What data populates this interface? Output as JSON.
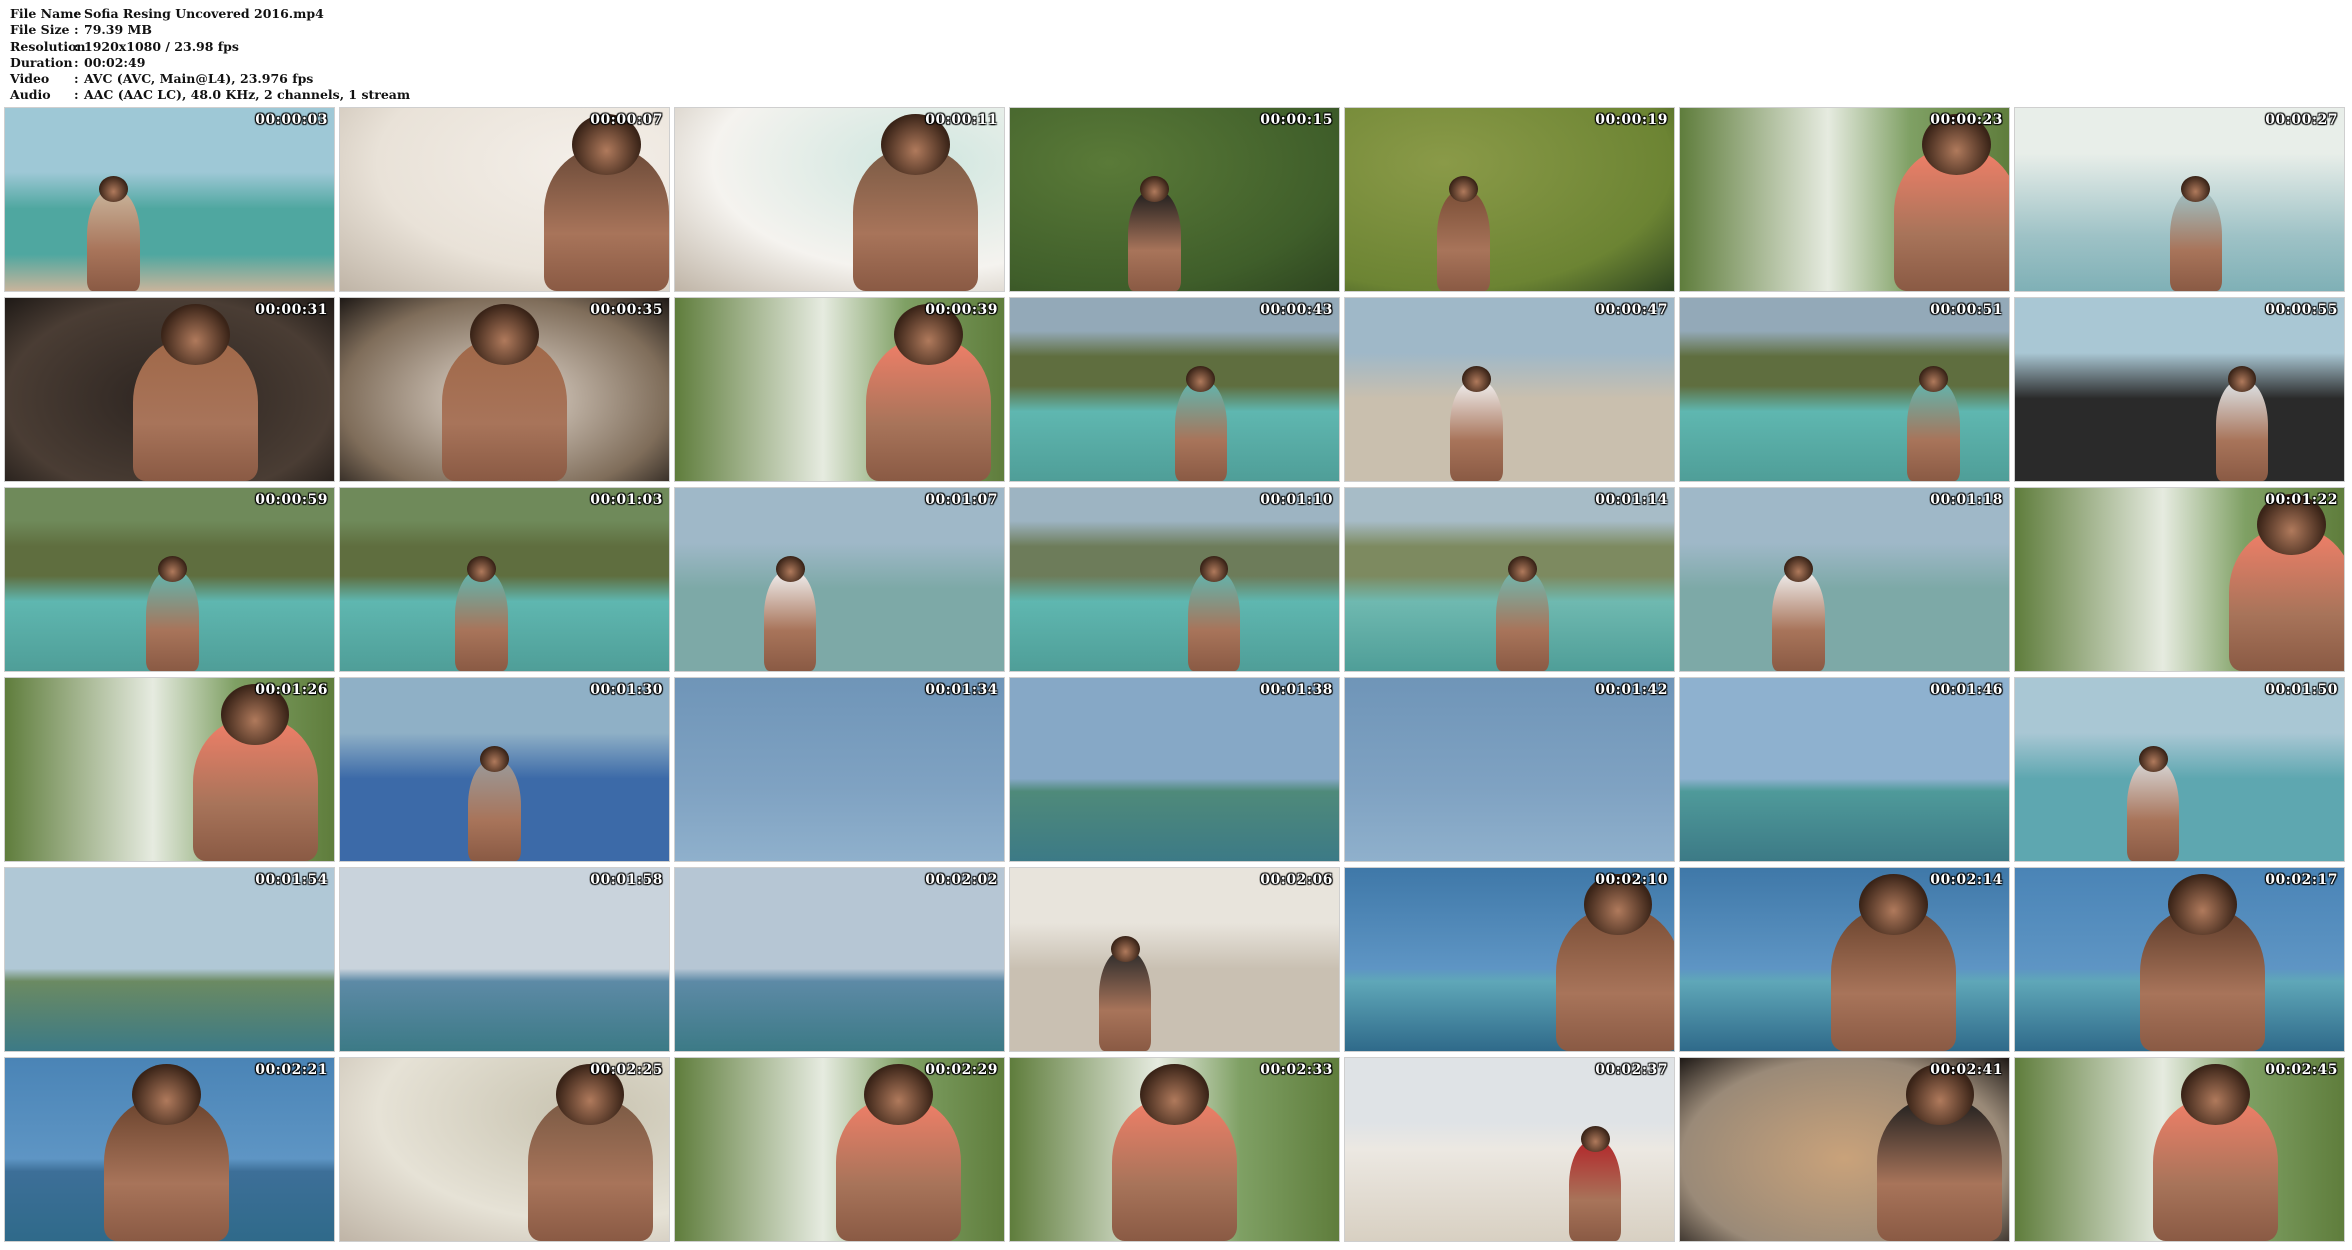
{
  "info": {
    "rows": [
      {
        "key": "File Name",
        "sep": ":",
        "value": "Sofia Resing Uncovered 2016.mp4"
      },
      {
        "key": "File Size",
        "sep": ":",
        "value": "79.39 MB"
      },
      {
        "key": "Resolution",
        "sep": ":",
        "value": "1920x1080 / 23.98 fps"
      },
      {
        "key": "Duration",
        "sep": ":",
        "value": "00:02:49"
      },
      {
        "key": "Video",
        "sep": ":",
        "value": "AVC (AVC, Main@L4), 23.976 fps"
      },
      {
        "key": "Audio",
        "sep": ":",
        "value": "AAC (AAC LC), 48.0 KHz, 2 channels, 1 stream"
      }
    ]
  },
  "thumbnails": [
    {
      "timestamp": "00:00:03",
      "scene": "beach-pier",
      "colors": [
        "#9ec8d6",
        "#4fa7a0",
        "#c9b49b"
      ]
    },
    {
      "timestamp": "00:00:07",
      "scene": "portrait-light",
      "colors": [
        "#e9e2d8",
        "#f4efe9",
        "#6b4a38"
      ]
    },
    {
      "timestamp": "00:00:11",
      "scene": "portrait-light",
      "colors": [
        "#f5f3ef",
        "#cfe6df",
        "#7a5a44"
      ]
    },
    {
      "timestamp": "00:00:15",
      "scene": "foliage",
      "colors": [
        "#5a7a38",
        "#3f5e2a",
        "#1c1c1c"
      ]
    },
    {
      "timestamp": "00:00:19",
      "scene": "foliage",
      "colors": [
        "#8a9a48",
        "#6c8433",
        "#7a4e36"
      ]
    },
    {
      "timestamp": "00:00:23",
      "scene": "hut",
      "colors": [
        "#8c6a42",
        "#5f7d3c",
        "#f27f68"
      ]
    },
    {
      "timestamp": "00:00:27",
      "scene": "cliff-sea",
      "colors": [
        "#e8eee9",
        "#3e6b3a",
        "#9ec2c6"
      ]
    },
    {
      "timestamp": "00:00:31",
      "scene": "rock",
      "colors": [
        "#4a3d34",
        "#2c2420",
        "#a06848"
      ]
    },
    {
      "timestamp": "00:00:35",
      "scene": "rock",
      "colors": [
        "#7f6d5a",
        "#e6dcd2",
        "#a06848"
      ]
    },
    {
      "timestamp": "00:00:39",
      "scene": "hut",
      "colors": [
        "#8c6a42",
        "#5f7d3c",
        "#f27f68"
      ]
    },
    {
      "timestamp": "00:00:43",
      "scene": "shore",
      "colors": [
        "#93a9b8",
        "#5f6e3f",
        "#5fb7b0"
      ]
    },
    {
      "timestamp": "00:00:47",
      "scene": "crew-beach",
      "colors": [
        "#9fb8c8",
        "#c9bfae",
        "#f2f2f2"
      ]
    },
    {
      "timestamp": "00:00:51",
      "scene": "shore",
      "colors": [
        "#93a9b8",
        "#5f6e3f",
        "#5fb7b0"
      ]
    },
    {
      "timestamp": "00:00:55",
      "scene": "crew-beach",
      "colors": [
        "#a9c7d4",
        "#2a2a2a",
        "#dfe6ea"
      ]
    },
    {
      "timestamp": "00:00:59",
      "scene": "shore",
      "colors": [
        "#6f8a5a",
        "#5f6e3f",
        "#5fb7b0"
      ]
    },
    {
      "timestamp": "00:01:03",
      "scene": "shore",
      "colors": [
        "#6f8a5a",
        "#5f6e3f",
        "#5fb7b0"
      ]
    },
    {
      "timestamp": "00:01:07",
      "scene": "crew-beach",
      "colors": [
        "#9fb8c8",
        "#7da9a7",
        "#f2f2f2"
      ]
    },
    {
      "timestamp": "00:01:10",
      "scene": "shore",
      "colors": [
        "#9db4c2",
        "#6d7c5a",
        "#5fb7b0"
      ]
    },
    {
      "timestamp": "00:01:14",
      "scene": "shore",
      "colors": [
        "#a7bcc7",
        "#7d8a60",
        "#6fb9b0"
      ]
    },
    {
      "timestamp": "00:01:18",
      "scene": "crew-beach",
      "colors": [
        "#9fb8c8",
        "#7da9a7",
        "#f2f2f2"
      ]
    },
    {
      "timestamp": "00:01:22",
      "scene": "hut",
      "colors": [
        "#8c6a42",
        "#5f7d3c",
        "#f27f68"
      ]
    },
    {
      "timestamp": "00:01:26",
      "scene": "hut",
      "colors": [
        "#8c6a42",
        "#5f7d3c",
        "#f27f68"
      ]
    },
    {
      "timestamp": "00:01:30",
      "scene": "crew-beach",
      "colors": [
        "#8fb0c6",
        "#3c6aa8",
        "#9a9a9a"
      ]
    },
    {
      "timestamp": "00:01:34",
      "scene": "sky",
      "colors": [
        "#7fa2c2",
        "#7fa2c2",
        "#e8e8e8"
      ]
    },
    {
      "timestamp": "00:01:38",
      "scene": "sky-sea",
      "colors": [
        "#86a8c6",
        "#4f8a7a",
        "#e8e8e8"
      ]
    },
    {
      "timestamp": "00:01:42",
      "scene": "sky",
      "colors": [
        "#7fa2c2",
        "#7fa2c2",
        "#e8e8e8"
      ]
    },
    {
      "timestamp": "00:01:46",
      "scene": "sky-sea",
      "colors": [
        "#8eb1cf",
        "#4f9a9a",
        "#e0a33a"
      ]
    },
    {
      "timestamp": "00:01:50",
      "scene": "crew-beach",
      "colors": [
        "#a9c7d4",
        "#5ea7b0",
        "#d8d8d8"
      ]
    },
    {
      "timestamp": "00:01:54",
      "scene": "sky-sea",
      "colors": [
        "#b0c8d6",
        "#6b8a62",
        "#e8e8e8"
      ]
    },
    {
      "timestamp": "00:01:58",
      "scene": "sky-sea",
      "colors": [
        "#c9d3dc",
        "#5d8aa6",
        "#2a2a2a"
      ]
    },
    {
      "timestamp": "00:02:02",
      "scene": "sky-sea",
      "colors": [
        "#b6c6d4",
        "#5d8aa6",
        "#2a2a2a"
      ]
    },
    {
      "timestamp": "00:02:06",
      "scene": "crew-beach",
      "colors": [
        "#e8e4dc",
        "#c9c0b2",
        "#2a2a2a"
      ]
    },
    {
      "timestamp": "00:02:10",
      "scene": "portrait-sea",
      "colors": [
        "#3f78a8",
        "#5fa7b8",
        "#7a4e36"
      ]
    },
    {
      "timestamp": "00:02:14",
      "scene": "portrait-sea",
      "colors": [
        "#3f78a8",
        "#5fa7b8",
        "#6a432d"
      ]
    },
    {
      "timestamp": "00:02:17",
      "scene": "portrait-sea",
      "colors": [
        "#4a84b6",
        "#5fa7b8",
        "#5c3a28"
      ]
    },
    {
      "timestamp": "00:02:21",
      "scene": "portrait-sea",
      "colors": [
        "#4a84b6",
        "#3d6f98",
        "#6a432d"
      ]
    },
    {
      "timestamp": "00:02:25",
      "scene": "portrait-light",
      "colors": [
        "#e6e2d6",
        "#c8c3b0",
        "#7a5a44"
      ]
    },
    {
      "timestamp": "00:02:29",
      "scene": "hut",
      "colors": [
        "#8c6a42",
        "#5f7d3c",
        "#f27f68"
      ]
    },
    {
      "timestamp": "00:02:33",
      "scene": "hut",
      "colors": [
        "#8c6a42",
        "#5f7d3c",
        "#f27f68"
      ]
    },
    {
      "timestamp": "00:02:37",
      "scene": "white-beach",
      "colors": [
        "#dfe3e6",
        "#ece8e2",
        "#b3262a"
      ]
    },
    {
      "timestamp": "00:02:41",
      "scene": "rock",
      "colors": [
        "#9a8a78",
        "#c9a27a",
        "#1e1e1e"
      ]
    },
    {
      "timestamp": "00:02:45",
      "scene": "hut",
      "colors": [
        "#8c6a42",
        "#5f7d3c",
        "#f27f68"
      ]
    }
  ]
}
